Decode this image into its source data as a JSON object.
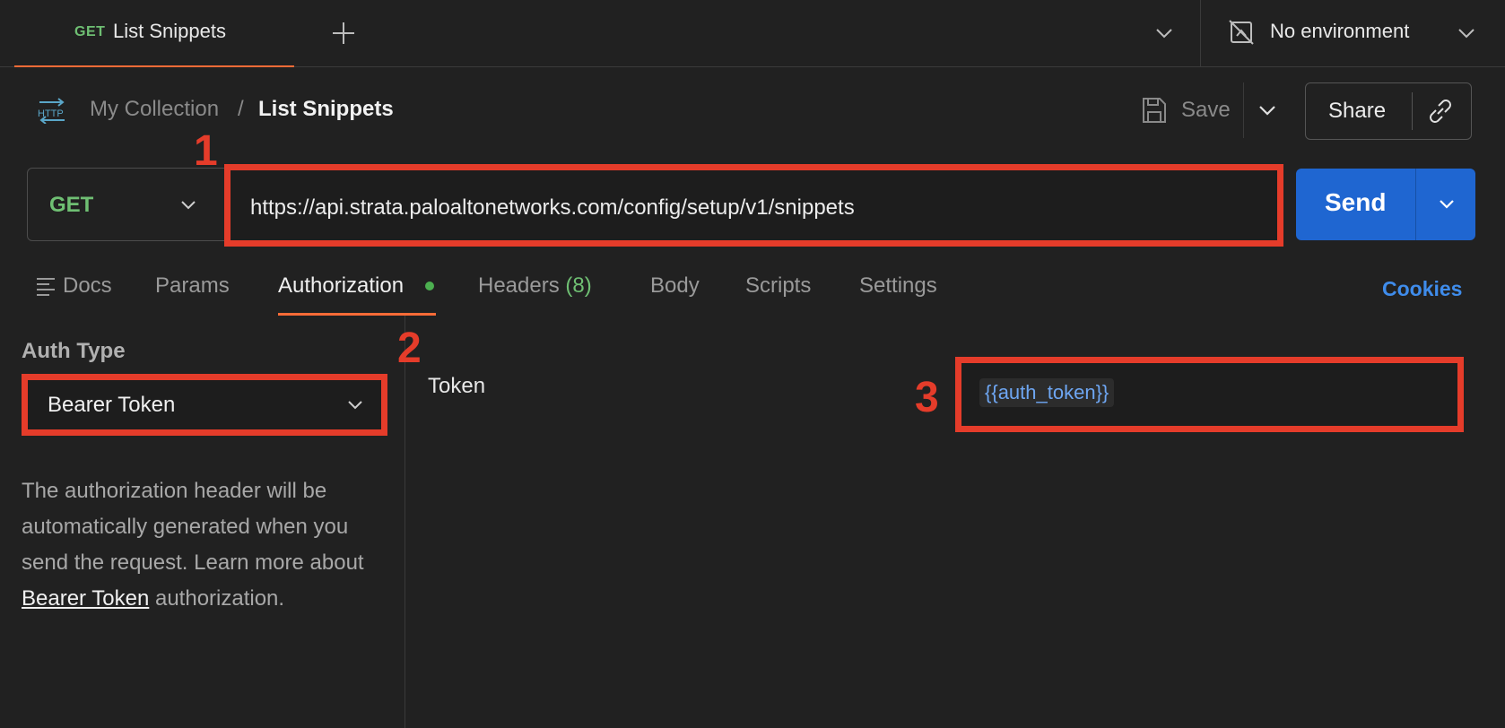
{
  "tab_bar": {
    "active_tab": {
      "method": "GET",
      "title": "List Snippets"
    },
    "environment": "No environment"
  },
  "breadcrumb": {
    "collection": "My Collection",
    "separator": "/",
    "request": "List Snippets"
  },
  "toolbar": {
    "save_label": "Save",
    "share_label": "Share"
  },
  "request": {
    "method": "GET",
    "url": "https://api.strata.paloaltonetworks.com/config/setup/v1/snippets",
    "send_label": "Send"
  },
  "subtabs": {
    "docs": "Docs",
    "params": "Params",
    "authorization": "Authorization",
    "headers": "Headers",
    "headers_count": "(8)",
    "body": "Body",
    "scripts": "Scripts",
    "settings": "Settings",
    "cookies": "Cookies"
  },
  "auth": {
    "heading": "Auth Type",
    "selected_type": "Bearer Token",
    "help_prefix": "The authorization header will be automatically generated when you send the request. Learn more about ",
    "help_link": "Bearer Token",
    "help_suffix": " authorization.",
    "token_label": "Token",
    "token_value": "{{auth_token}}"
  },
  "annotations": {
    "one": "1",
    "two": "2",
    "three": "3"
  },
  "colors": {
    "accent": "#ff6c37",
    "send": "#1f66d1",
    "method_get": "#6fbf73",
    "annotation": "#e53c2a",
    "variable": "#6ea6f2"
  }
}
